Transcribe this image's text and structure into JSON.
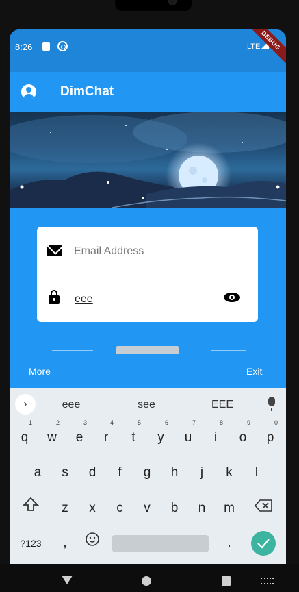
{
  "status_bar": {
    "time": "8:26",
    "network": "LTE",
    "debug_banner": "DEBUG"
  },
  "app_bar": {
    "title": "DimChat",
    "leading_icon": "account-circle-icon"
  },
  "login_form": {
    "email_placeholder": "Email Address",
    "email_value": "",
    "password_value": "eee",
    "email_icon": "mail-icon",
    "password_icon": "lock-icon",
    "visibility_icon": "eye-icon"
  },
  "actions": {
    "left": "More",
    "right": "Exit"
  },
  "keyboard": {
    "suggestions": [
      "eee",
      "see",
      "EEE"
    ],
    "row1": [
      {
        "key": "q",
        "hint": "1"
      },
      {
        "key": "w",
        "hint": "2"
      },
      {
        "key": "e",
        "hint": "3"
      },
      {
        "key": "r",
        "hint": "4"
      },
      {
        "key": "t",
        "hint": "5"
      },
      {
        "key": "y",
        "hint": "6"
      },
      {
        "key": "u",
        "hint": "7"
      },
      {
        "key": "i",
        "hint": "8"
      },
      {
        "key": "o",
        "hint": "9"
      },
      {
        "key": "p",
        "hint": "0"
      }
    ],
    "row2": [
      "a",
      "s",
      "d",
      "f",
      "g",
      "h",
      "j",
      "k",
      "l"
    ],
    "row3": [
      "z",
      "x",
      "c",
      "v",
      "b",
      "n",
      "m"
    ],
    "symbols_key": "?123",
    "comma_key": ",",
    "period_key": "."
  },
  "colors": {
    "primary": "#2196F3",
    "status_bar": "#1f85d8",
    "enter_key": "#3cb4a0"
  }
}
